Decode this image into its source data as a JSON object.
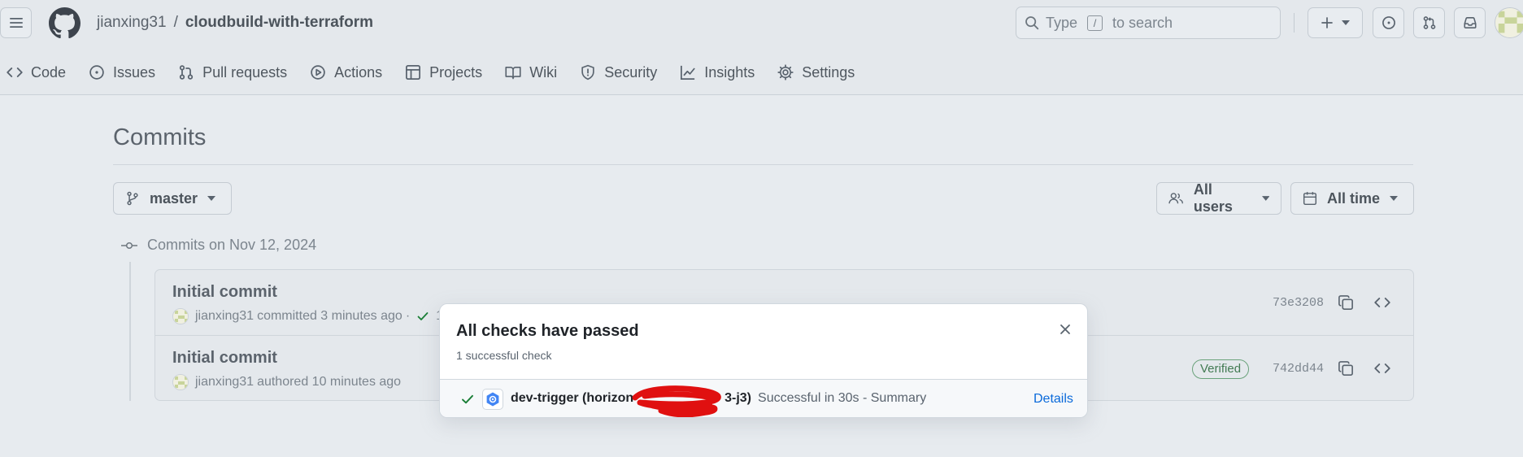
{
  "header": {
    "owner": "jianxing31",
    "separator": "/",
    "repo": "cloudbuild-with-terraform",
    "search": {
      "prefix": "Type",
      "kbd": "/",
      "suffix": "to search"
    }
  },
  "nav": {
    "items": [
      {
        "label": "Code",
        "icon": "code-icon"
      },
      {
        "label": "Issues",
        "icon": "issue-icon"
      },
      {
        "label": "Pull requests",
        "icon": "pull-request-icon"
      },
      {
        "label": "Actions",
        "icon": "play-icon"
      },
      {
        "label": "Projects",
        "icon": "table-icon"
      },
      {
        "label": "Wiki",
        "icon": "book-icon"
      },
      {
        "label": "Security",
        "icon": "shield-icon"
      },
      {
        "label": "Insights",
        "icon": "graph-icon"
      },
      {
        "label": "Settings",
        "icon": "gear-icon"
      }
    ]
  },
  "page": {
    "title": "Commits",
    "branch": "master",
    "users_filter": "All users",
    "time_filter": "All time",
    "group_label": "Commits on Nov 12, 2024"
  },
  "commits": [
    {
      "title": "Initial commit",
      "author": "jianxing31",
      "action": "committed 3 minutes ago",
      "dot": "·",
      "checks": "1 /",
      "sha": "73e3208"
    },
    {
      "title": "Initial commit",
      "author": "jianxing31",
      "action": "authored 10 minutes ago",
      "verified": "Verified",
      "sha": "742dd44"
    }
  ],
  "popover": {
    "title": "All checks have passed",
    "subtitle": "1 successful check",
    "check": {
      "name_start": "dev-trigger (horizon",
      "name_end": "3-j3)",
      "status": "Successful in 30s - Summary",
      "details": "Details"
    }
  },
  "colors": {
    "success": "#1a7f37",
    "link": "#0969da",
    "redaction": "#e01010"
  }
}
